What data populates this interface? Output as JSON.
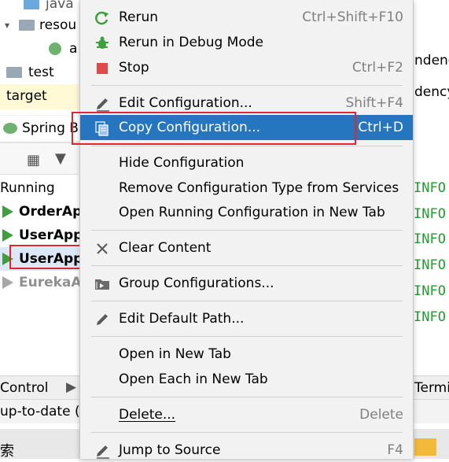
{
  "project_tree": {
    "items": [
      {
        "label": "java"
      },
      {
        "label": "resou"
      },
      {
        "label": "a"
      },
      {
        "label": "test"
      },
      {
        "label": "target"
      }
    ]
  },
  "run_tab": {
    "label": "Spring B"
  },
  "services": {
    "group_label": "Running",
    "items": [
      {
        "label": "OrderAp"
      },
      {
        "label": "UserApp"
      },
      {
        "label": "UserApp"
      },
      {
        "label": "EurekaA"
      }
    ]
  },
  "right_pane": {
    "top_texts": [
      "ndenc",
      "dency"
    ],
    "log_levels": [
      "INFO",
      "INFO",
      "INFO",
      "INFO",
      "INFO",
      "INFO"
    ],
    "bottom_text": "Termi"
  },
  "bottom_bar": {
    "control_label": "Control"
  },
  "status_bar": {
    "text": "up-to-date ("
  },
  "taskbar": {
    "text": "索"
  },
  "menu": {
    "rerun": {
      "label": "Rerun",
      "shortcut": "Ctrl+Shift+F10"
    },
    "rerun_debug": {
      "label": "Rerun in Debug Mode"
    },
    "stop": {
      "label": "Stop",
      "shortcut": "Ctrl+F2"
    },
    "edit_configuration": {
      "label": "Edit Configuration...",
      "shortcut": "Shift+F4"
    },
    "copy_configuration": {
      "label": "Copy Configuration...",
      "shortcut": "Ctrl+D"
    },
    "hide_configuration": {
      "label": "Hide Configuration"
    },
    "remove_config_type": {
      "label": "Remove Configuration Type from Services"
    },
    "open_running_config": {
      "label": "Open Running Configuration in New Tab"
    },
    "clear_content": {
      "label": "Clear Content"
    },
    "group_configurations": {
      "label": "Group Configurations..."
    },
    "edit_default_path": {
      "label": "Edit Default Path..."
    },
    "open_new_tab": {
      "label": "Open in New Tab"
    },
    "open_each_new_tab": {
      "label": "Open Each in New Tab"
    },
    "delete": {
      "label": "Delete...",
      "shortcut": "Delete"
    },
    "jump_to_source": {
      "label": "Jump to Source",
      "shortcut": "F4"
    }
  },
  "colors": {
    "selection": "#2675bf",
    "highlight_box": "#e0272f",
    "run_green": "#3f9f3f",
    "stop_red": "#e04a4a",
    "info_green": "#1f9e2e"
  }
}
